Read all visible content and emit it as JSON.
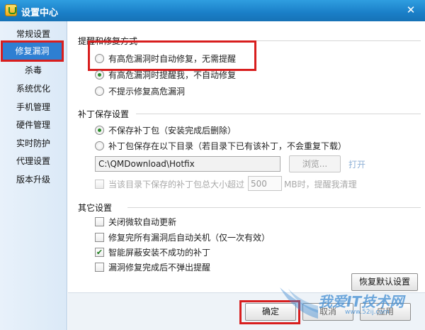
{
  "window": {
    "title": "设置中心",
    "close_glyph": "✕"
  },
  "sidebar": {
    "items": [
      {
        "label": "常规设置"
      },
      {
        "label": "修复漏洞"
      },
      {
        "label": "杀毒"
      },
      {
        "label": "系统优化"
      },
      {
        "label": "手机管理"
      },
      {
        "label": "硬件管理"
      },
      {
        "label": "实时防护"
      },
      {
        "label": "代理设置"
      },
      {
        "label": "版本升级"
      }
    ],
    "active_index": 1
  },
  "repair_method": {
    "title": "提醒和修复方式",
    "options": [
      {
        "label": "有高危漏洞时自动修复，无需提醒",
        "selected": false
      },
      {
        "label": "有高危漏洞时提醒我，不自动修复",
        "selected": true
      },
      {
        "label": "不提示修复高危漏洞",
        "selected": false
      }
    ]
  },
  "patch_save": {
    "title": "补丁保存设置",
    "options": [
      {
        "label": "不保存补丁包（安装完成后删除）",
        "selected": true
      },
      {
        "label": "补丁包保存在以下目录（若目录下已有该补丁，不会重复下载）",
        "selected": false
      }
    ],
    "path_value": "C:\\QMDownload\\Hotfix",
    "browse_label": "浏览...",
    "open_label": "打开",
    "cleanup_label_pre": "当该目录下保存的补丁包总大小超过",
    "cleanup_size_value": "500",
    "cleanup_label_post": "MB时，提醒我清理",
    "cleanup_checked": false
  },
  "other": {
    "title": "其它设置",
    "options": [
      {
        "label": "关闭微软自动更新",
        "checked": false
      },
      {
        "label": "修复完所有漏洞后自动关机（仅一次有效）",
        "checked": false
      },
      {
        "label": "智能屏蔽安装不成功的补丁",
        "checked": true
      },
      {
        "label": "漏洞修复完成后不弹出提醒",
        "checked": false
      }
    ],
    "restore_label": "恢复默认设置"
  },
  "footer": {
    "ok_label": "确定",
    "cancel_label": "取消",
    "apply_label": "应用"
  },
  "watermark": {
    "main": "我爱IT技术网",
    "sub": "www.52ij.com"
  },
  "colors": {
    "titlebar": "#1a7fc8",
    "active_nav": "#2e7fd2",
    "highlight": "#d81e1e",
    "radio_on": "#2c8d2c"
  }
}
